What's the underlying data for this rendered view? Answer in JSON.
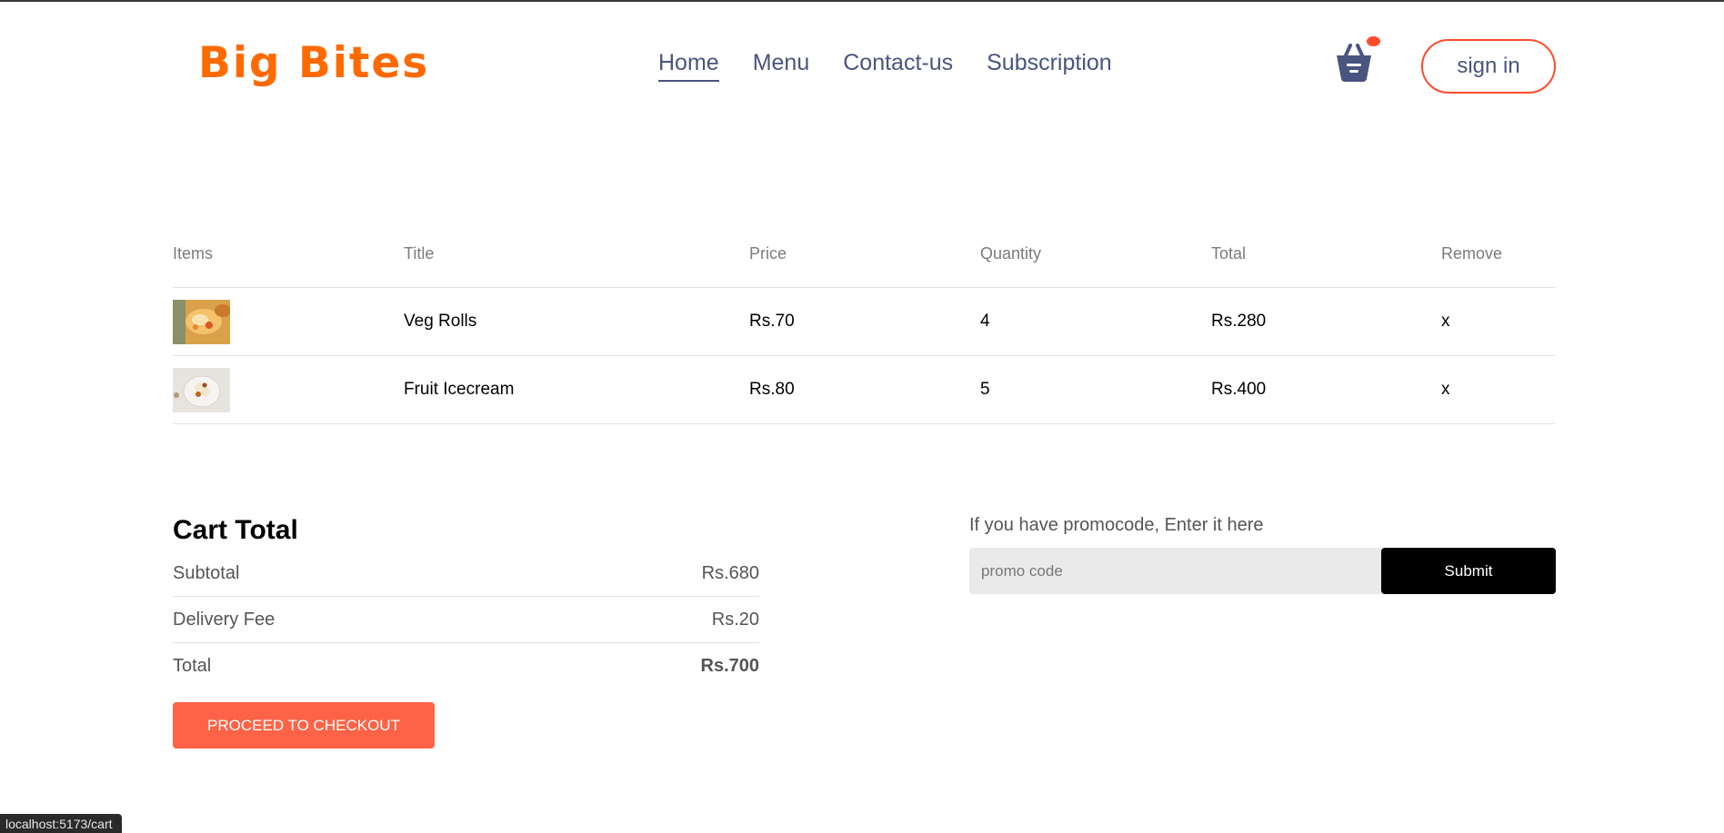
{
  "header": {
    "logo": "Big Bites",
    "nav": [
      "Home",
      "Menu",
      "Contact-us",
      "Subscription"
    ],
    "active_nav": "Home",
    "sign_in": "sign in",
    "basket_icon": "basket-icon"
  },
  "cart": {
    "columns": [
      "Items",
      "Title",
      "Price",
      "Quantity",
      "Total",
      "Remove"
    ],
    "items": [
      {
        "image": "veg-rolls-thumbnail",
        "title": "Veg Rolls",
        "price": "Rs.70",
        "quantity": "4",
        "total": "Rs.280",
        "remove": "x"
      },
      {
        "image": "fruit-icecream-thumbnail",
        "title": "Fruit Icecream",
        "price": "Rs.80",
        "quantity": "5",
        "total": "Rs.400",
        "remove": "x"
      }
    ]
  },
  "totals": {
    "heading": "Cart Total",
    "subtotal_label": "Subtotal",
    "subtotal_value": "Rs.680",
    "delivery_label": "Delivery Fee",
    "delivery_value": "Rs.20",
    "total_label": "Total",
    "total_value": "Rs.700",
    "checkout_label": "PROCEED TO CHECKOUT"
  },
  "promo": {
    "prompt": "If you have promocode, Enter it here",
    "placeholder": "promo code",
    "submit_label": "Submit"
  },
  "status_bar": {
    "url": "localhost:5173/cart"
  },
  "colors": {
    "brand": "#ff6a00",
    "accent": "#ff6347",
    "nav_text": "#49557e"
  }
}
